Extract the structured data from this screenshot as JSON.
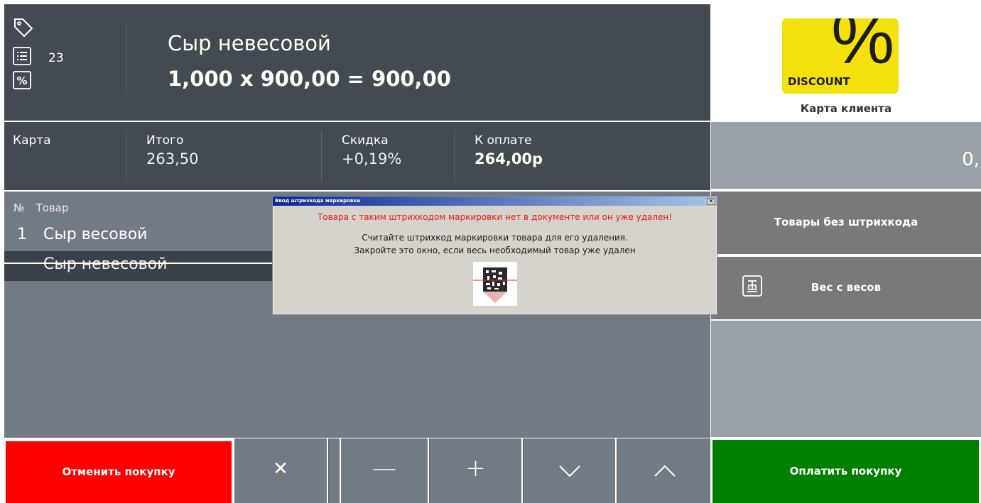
{
  "header": {
    "item_count": "23",
    "product_name": "Сыр невесовой",
    "calculation": "1,000 x 900,00 = 900,00",
    "icons": [
      "tag-icon",
      "list-icon",
      "percent-icon"
    ]
  },
  "totals": {
    "card_label": "Карта",
    "total_label": "Итого",
    "total_value": "263,50",
    "discount_label": "Скидка",
    "discount_value": "+0,19%",
    "pay_label": "К оплате",
    "pay_value": "264,00р"
  },
  "list": {
    "col_num": "№",
    "col_product": "Товар",
    "items": [
      {
        "num": "1",
        "name": "Сыр весовой"
      },
      {
        "num": "",
        "name": "Сыр невесовой",
        "removed": true
      }
    ]
  },
  "right_panel": {
    "discount_logo": "DISCOUNT",
    "discount_symbol": "%",
    "card_label": "Карта клиента",
    "amount": "0,",
    "no_barcode_button": "Товары без штрихкода",
    "scale_button": "Вес с весов",
    "scale_icon": "scale-icon"
  },
  "bottom": {
    "cancel_button": "Отменить покупку",
    "pay_button": "Оплатить покупку",
    "delete_glyph": "✕",
    "minus_glyph": "—",
    "plus_glyph": "+",
    "down_glyph": "﹀",
    "up_glyph": "︿"
  },
  "dialog": {
    "title": "Ввод штрихкода маркировки",
    "close_glyph": "✕",
    "error": "Товара с таким штрихкодом маркировки нет в документе или он уже удален!",
    "message_1": "Считайте штрихкод маркировки товара для его удаления.",
    "message_2": "Закройте это окно, если весь необходимый товар уже удален"
  },
  "colors": {
    "header_bg": "#434a52",
    "list_bg": "#727a84",
    "cancel_red": "#fe0000",
    "pay_green": "#018000",
    "discount_yellow": "#f4e00a",
    "error_red": "#e51b1b"
  }
}
